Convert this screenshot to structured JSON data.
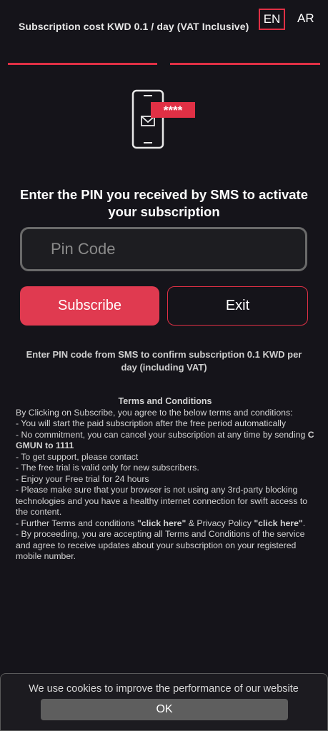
{
  "header": {
    "cost_text": "Subscription cost KWD 0.1 / day (VAT Inclusive)",
    "lang_en": "EN",
    "lang_ar": "AR"
  },
  "illustration": {
    "pin_mask": "****",
    "icon": "phone-sms-icon"
  },
  "main": {
    "headline": "Enter the PIN you received by SMS to activate your subscription",
    "pin_placeholder": "Pin Code",
    "subscribe_label": "Subscribe",
    "exit_label": "Exit",
    "confirm_text": "Enter PIN code from SMS to confirm subscription 0.1 KWD per day (including VAT)"
  },
  "terms": {
    "title": "Terms and Conditions",
    "intro": "By Clicking on Subscribe, you agree to the below terms and conditions:",
    "item1": "-  You will start the paid subscription after the free period automatically",
    "item2_pre": "- No commitment, you can cancel your subscription at any time by sending ",
    "item2_code": "  C GMUN to 1111",
    "item3": "- To get support, please contact",
    "item4": "- The free trial is valid only for new subscribers.",
    "item5": "- Enjoy your Free trial for 24 hours",
    "item6": "- Please make sure that your browser is not using any 3rd-party blocking technologies and you have a healthy internet connection for swift access to the content.",
    "item7_pre": "- Further Terms and conditions ",
    "item7_link1": "\"click here\"",
    "item7_mid": " & Privacy Policy ",
    "item7_link2": "\"click here\"",
    "item7_end": ".",
    "item8": "- By proceeding, you are accepting all Terms and Conditions of the service and agree to receive updates about your subscription on your registered mobile number."
  },
  "cookie": {
    "text": "We use cookies to improve the performance of our website",
    "ok_label": "OK"
  },
  "colors": {
    "accent": "#e03045",
    "background": "#15141a"
  }
}
